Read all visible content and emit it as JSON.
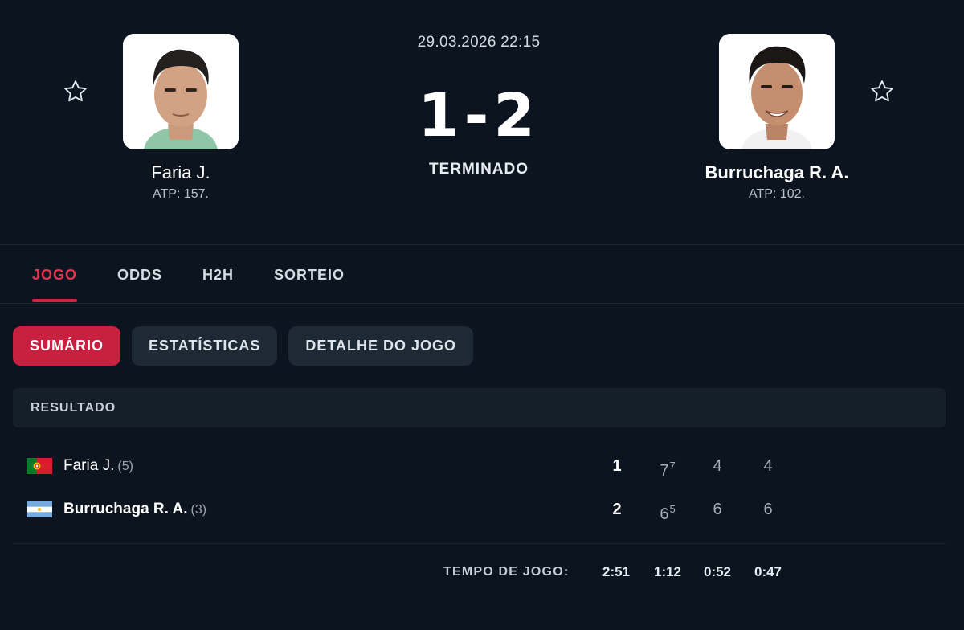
{
  "header": {
    "date_time": "29.03.2026 22:15",
    "score": "1-2",
    "status": "TERMINADO",
    "home": {
      "name": "Faria J.",
      "rank": "ATP: 157."
    },
    "away": {
      "name": "Burruchaga R. A.",
      "rank": "ATP: 102."
    }
  },
  "tabs": [
    {
      "label": "JOGO",
      "active": true
    },
    {
      "label": "ODDS",
      "active": false
    },
    {
      "label": "H2H",
      "active": false
    },
    {
      "label": "SORTEIO",
      "active": false
    }
  ],
  "subtabs": [
    {
      "label": "SUMÁRIO",
      "active": true
    },
    {
      "label": "ESTATÍSTICAS",
      "active": false
    },
    {
      "label": "DETALHE DO JOGO",
      "active": false
    }
  ],
  "result": {
    "title": "RESULTADO",
    "rows": [
      {
        "flag": "portugal-flag",
        "name": "Faria J.",
        "seed": "(5)",
        "total": "1",
        "sets": [
          {
            "games": "7",
            "tiebreak": "7"
          },
          {
            "games": "4",
            "tiebreak": ""
          },
          {
            "games": "4",
            "tiebreak": ""
          }
        ]
      },
      {
        "flag": "argentina-flag",
        "name": "Burruchaga R. A.",
        "seed": "(3)",
        "total": "2",
        "sets": [
          {
            "games": "6",
            "tiebreak": "5"
          },
          {
            "games": "6",
            "tiebreak": ""
          },
          {
            "games": "6",
            "tiebreak": ""
          }
        ]
      }
    ]
  },
  "game_time": {
    "label": "TEMPO DE JOGO:",
    "total": "2:51",
    "sets": [
      "1:12",
      "0:52",
      "0:47"
    ]
  },
  "colors": {
    "background": "#0c151f",
    "accent": "#c8213f",
    "accent_text": "#e2344e",
    "chip_bg": "#1d2935"
  },
  "icons": {
    "favorite": "star-outline-icon"
  }
}
